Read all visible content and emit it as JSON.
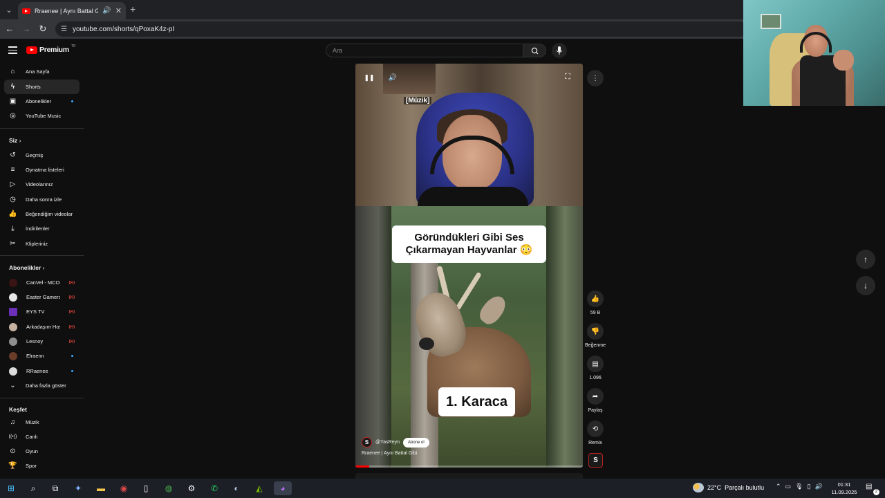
{
  "browser": {
    "tab_title": "Rraenee | Aynı Battal Gibi -",
    "url": "youtube.com/shorts/qPoxaK4z-pI",
    "icons": {
      "tab_list": "chevron-down-icon",
      "audio": "speaker-icon",
      "close": "close-icon",
      "new_tab": "plus-icon",
      "back": "arrow-left-icon",
      "forward": "arrow-right-icon",
      "reload": "reload-icon",
      "site_info": "tune-icon"
    }
  },
  "youtube": {
    "logo_text": "Premium",
    "logo_country": "TR",
    "search_placeholder": "Ara",
    "sidebar": {
      "main": [
        {
          "label": "Ana Sayfa",
          "icon": "home-icon"
        },
        {
          "label": "Shorts",
          "icon": "shorts-icon",
          "active": true
        },
        {
          "label": "Abonelikler",
          "icon": "subscriptions-icon",
          "dot": true
        },
        {
          "label": "YouTube Music",
          "icon": "music-circle-icon"
        }
      ],
      "you_heading": "Siz",
      "you": [
        {
          "label": "Geçmiş",
          "icon": "history-icon"
        },
        {
          "label": "Oynatma listeleri",
          "icon": "playlist-icon"
        },
        {
          "label": "Videolarınız",
          "icon": "video-icon"
        },
        {
          "label": "Daha sonra izle",
          "icon": "clock-icon"
        },
        {
          "label": "Beğendiğim videolar",
          "icon": "thumbs-up-icon"
        },
        {
          "label": "İndirilenler",
          "icon": "download-icon"
        },
        {
          "label": "Klipleriniz",
          "icon": "scissors-icon"
        }
      ],
      "subs_heading": "Abonelikler",
      "subscriptions": [
        {
          "label": "CanVel - MCOC",
          "status": "live",
          "color": "#3a1414"
        },
        {
          "label": "Easter GamersTv",
          "status": "live",
          "color": "#e6e6e6"
        },
        {
          "label": "EYS TV",
          "status": "live",
          "color": "#6b2fb8"
        },
        {
          "label": "Arkadaşım Hoşg...",
          "status": "live",
          "color": "#c7b2a2"
        },
        {
          "label": "Lesnoy",
          "status": "live",
          "color": "#8f8f8f"
        },
        {
          "label": "Elraenn",
          "status": "dot",
          "color": "#6a3c2a"
        },
        {
          "label": "RRaenee",
          "status": "dot",
          "color": "#dcdcdc"
        }
      ],
      "show_more": "Daha fazla göster",
      "explore_heading": "Keşfet",
      "explore": [
        {
          "label": "Müzik",
          "icon": "music-note-icon"
        },
        {
          "label": "Canlı",
          "icon": "live-icon"
        },
        {
          "label": "Oyun",
          "icon": "gamepad-icon"
        },
        {
          "label": "Spor",
          "icon": "trophy-icon"
        }
      ]
    },
    "short": {
      "subtitle": "[Müzik]",
      "title_card": "Göründükleri Gibi Ses Çıkarmayan Hayvanlar 😳",
      "label_card": "1. Karaca",
      "channel_handle": "@YasReyn",
      "subscribe": "Abone ol",
      "video_title": "Rraenee | Aynı Battal Gibi",
      "progress": 0.06
    },
    "actions": {
      "like_count": "59 B",
      "dislike_label": "Beğenme",
      "comments_count": "1.096",
      "share_label": "Paylaş",
      "remix_label": "Remix"
    }
  },
  "taskbar": {
    "weather_temp": "22°C",
    "weather_text": "Parçalı bulutlu",
    "time": "01:31",
    "date": "11.09.2025",
    "notif_count": "2"
  }
}
